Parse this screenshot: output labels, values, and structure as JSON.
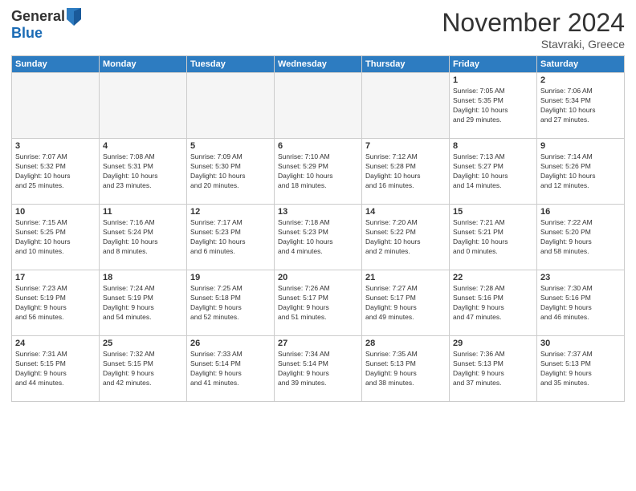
{
  "header": {
    "logo_line1": "General",
    "logo_line2": "Blue",
    "month_title": "November 2024",
    "location": "Stavraki, Greece"
  },
  "weekdays": [
    "Sunday",
    "Monday",
    "Tuesday",
    "Wednesday",
    "Thursday",
    "Friday",
    "Saturday"
  ],
  "weeks": [
    [
      {
        "day": "",
        "info": ""
      },
      {
        "day": "",
        "info": ""
      },
      {
        "day": "",
        "info": ""
      },
      {
        "day": "",
        "info": ""
      },
      {
        "day": "",
        "info": ""
      },
      {
        "day": "1",
        "info": "Sunrise: 7:05 AM\nSunset: 5:35 PM\nDaylight: 10 hours\nand 29 minutes."
      },
      {
        "day": "2",
        "info": "Sunrise: 7:06 AM\nSunset: 5:34 PM\nDaylight: 10 hours\nand 27 minutes."
      }
    ],
    [
      {
        "day": "3",
        "info": "Sunrise: 7:07 AM\nSunset: 5:32 PM\nDaylight: 10 hours\nand 25 minutes."
      },
      {
        "day": "4",
        "info": "Sunrise: 7:08 AM\nSunset: 5:31 PM\nDaylight: 10 hours\nand 23 minutes."
      },
      {
        "day": "5",
        "info": "Sunrise: 7:09 AM\nSunset: 5:30 PM\nDaylight: 10 hours\nand 20 minutes."
      },
      {
        "day": "6",
        "info": "Sunrise: 7:10 AM\nSunset: 5:29 PM\nDaylight: 10 hours\nand 18 minutes."
      },
      {
        "day": "7",
        "info": "Sunrise: 7:12 AM\nSunset: 5:28 PM\nDaylight: 10 hours\nand 16 minutes."
      },
      {
        "day": "8",
        "info": "Sunrise: 7:13 AM\nSunset: 5:27 PM\nDaylight: 10 hours\nand 14 minutes."
      },
      {
        "day": "9",
        "info": "Sunrise: 7:14 AM\nSunset: 5:26 PM\nDaylight: 10 hours\nand 12 minutes."
      }
    ],
    [
      {
        "day": "10",
        "info": "Sunrise: 7:15 AM\nSunset: 5:25 PM\nDaylight: 10 hours\nand 10 minutes."
      },
      {
        "day": "11",
        "info": "Sunrise: 7:16 AM\nSunset: 5:24 PM\nDaylight: 10 hours\nand 8 minutes."
      },
      {
        "day": "12",
        "info": "Sunrise: 7:17 AM\nSunset: 5:23 PM\nDaylight: 10 hours\nand 6 minutes."
      },
      {
        "day": "13",
        "info": "Sunrise: 7:18 AM\nSunset: 5:23 PM\nDaylight: 10 hours\nand 4 minutes."
      },
      {
        "day": "14",
        "info": "Sunrise: 7:20 AM\nSunset: 5:22 PM\nDaylight: 10 hours\nand 2 minutes."
      },
      {
        "day": "15",
        "info": "Sunrise: 7:21 AM\nSunset: 5:21 PM\nDaylight: 10 hours\nand 0 minutes."
      },
      {
        "day": "16",
        "info": "Sunrise: 7:22 AM\nSunset: 5:20 PM\nDaylight: 9 hours\nand 58 minutes."
      }
    ],
    [
      {
        "day": "17",
        "info": "Sunrise: 7:23 AM\nSunset: 5:19 PM\nDaylight: 9 hours\nand 56 minutes."
      },
      {
        "day": "18",
        "info": "Sunrise: 7:24 AM\nSunset: 5:19 PM\nDaylight: 9 hours\nand 54 minutes."
      },
      {
        "day": "19",
        "info": "Sunrise: 7:25 AM\nSunset: 5:18 PM\nDaylight: 9 hours\nand 52 minutes."
      },
      {
        "day": "20",
        "info": "Sunrise: 7:26 AM\nSunset: 5:17 PM\nDaylight: 9 hours\nand 51 minutes."
      },
      {
        "day": "21",
        "info": "Sunrise: 7:27 AM\nSunset: 5:17 PM\nDaylight: 9 hours\nand 49 minutes."
      },
      {
        "day": "22",
        "info": "Sunrise: 7:28 AM\nSunset: 5:16 PM\nDaylight: 9 hours\nand 47 minutes."
      },
      {
        "day": "23",
        "info": "Sunrise: 7:30 AM\nSunset: 5:16 PM\nDaylight: 9 hours\nand 46 minutes."
      }
    ],
    [
      {
        "day": "24",
        "info": "Sunrise: 7:31 AM\nSunset: 5:15 PM\nDaylight: 9 hours\nand 44 minutes."
      },
      {
        "day": "25",
        "info": "Sunrise: 7:32 AM\nSunset: 5:15 PM\nDaylight: 9 hours\nand 42 minutes."
      },
      {
        "day": "26",
        "info": "Sunrise: 7:33 AM\nSunset: 5:14 PM\nDaylight: 9 hours\nand 41 minutes."
      },
      {
        "day": "27",
        "info": "Sunrise: 7:34 AM\nSunset: 5:14 PM\nDaylight: 9 hours\nand 39 minutes."
      },
      {
        "day": "28",
        "info": "Sunrise: 7:35 AM\nSunset: 5:13 PM\nDaylight: 9 hours\nand 38 minutes."
      },
      {
        "day": "29",
        "info": "Sunrise: 7:36 AM\nSunset: 5:13 PM\nDaylight: 9 hours\nand 37 minutes."
      },
      {
        "day": "30",
        "info": "Sunrise: 7:37 AM\nSunset: 5:13 PM\nDaylight: 9 hours\nand 35 minutes."
      }
    ]
  ]
}
